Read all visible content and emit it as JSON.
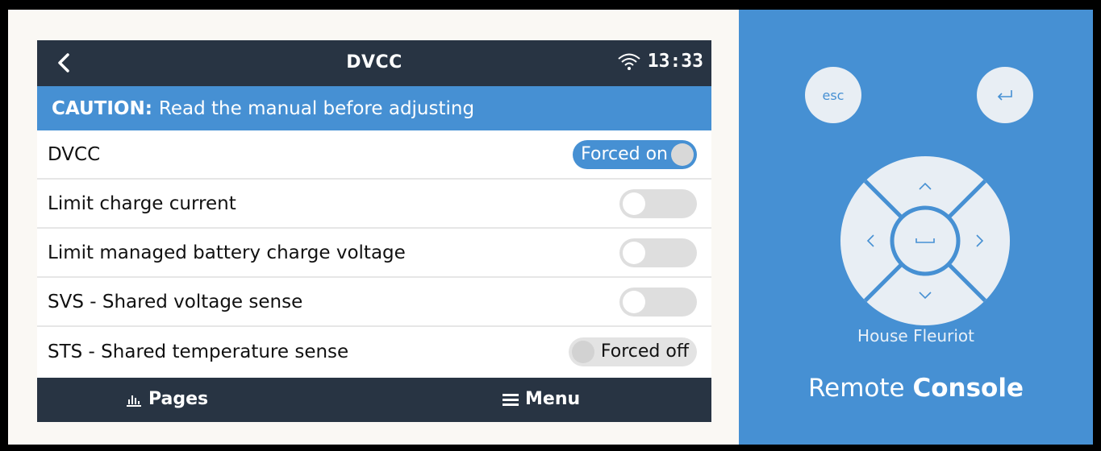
{
  "screen": {
    "title": "DVCC",
    "time": "13:33",
    "caution_bold": "CAUTION:",
    "caution_text": "Read the manual before adjusting",
    "rows": [
      {
        "label": "DVCC",
        "control": "Forced on"
      },
      {
        "label": "Limit charge current",
        "control": ""
      },
      {
        "label": "Limit managed battery charge voltage",
        "control": ""
      },
      {
        "label": "SVS - Shared voltage sense",
        "control": ""
      },
      {
        "label": "STS - Shared temperature sense",
        "control": "Forced off"
      }
    ],
    "bottom": {
      "pages": "Pages",
      "menu": "Menu"
    }
  },
  "remote": {
    "esc_label": "esc",
    "device_name": "House Fleuriot",
    "brand_regular": "Remote",
    "brand_bold": "Console"
  },
  "colors": {
    "bar_dark": "#283443",
    "accent_blue": "#4690d3",
    "toggle_off": "#dedede"
  },
  "icons": [
    "back-chevron-icon",
    "wifi-icon",
    "pages-chart-icon",
    "hamburger-menu-icon",
    "enter-arrow-icon",
    "dpad-up-icon",
    "dpad-down-icon",
    "dpad-left-icon",
    "dpad-right-icon",
    "space-center-icon"
  ]
}
